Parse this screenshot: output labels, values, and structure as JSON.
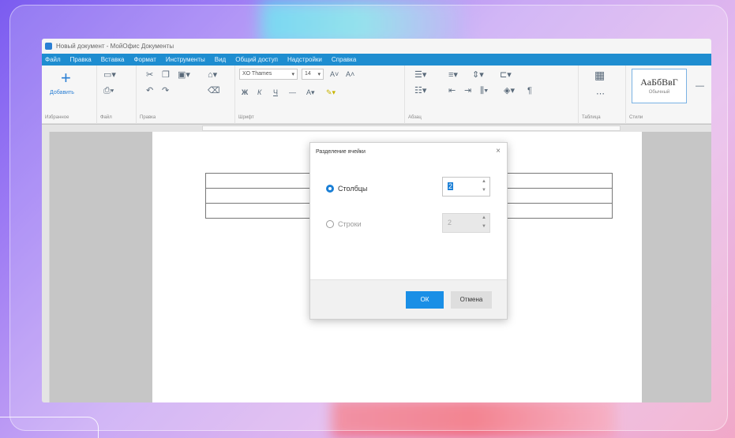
{
  "window": {
    "title": "Новый документ - МойОфис Документы"
  },
  "menu": [
    "Файл",
    "Правка",
    "Вставка",
    "Формат",
    "Инструменты",
    "Вид",
    "Общий доступ",
    "Надстройки",
    "Справка"
  ],
  "ribbon": {
    "add_label": "Добавить",
    "groups": {
      "insert": "Избранное",
      "file": "Файл",
      "edit": "Правка",
      "font": "Шрифт",
      "paragraph": "Абзац",
      "table": "Таблица",
      "styles": "Стили"
    },
    "font_name": "XO Thames",
    "font_size": "14",
    "style_sample": "АаБбВвГ",
    "style_name": "Обычный"
  },
  "dialog": {
    "title": "Разделение ячейки",
    "close": "×",
    "columns_label": "Столбцы",
    "columns_value": "2",
    "rows_label": "Строки",
    "rows_value": "2",
    "ok_label": "ОК",
    "cancel_label": "Отмена"
  },
  "colors": {
    "accent": "#1a8fe6",
    "menubar": "#1e8dd0"
  }
}
